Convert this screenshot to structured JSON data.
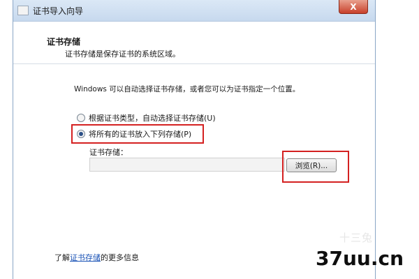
{
  "window": {
    "title": "证书导入向导",
    "close_label": "X"
  },
  "header": {
    "title": "证书存储",
    "description": "证书存储是保存证书的系统区域。"
  },
  "content": {
    "intro": "Windows 可以自动选择证书存储，或者您可以为证书指定一个位置。",
    "options": [
      {
        "label": "根据证书类型，自动选择证书存储(U)",
        "selected": false
      },
      {
        "label": "将所有的证书放入下列存储(P)",
        "selected": true
      }
    ],
    "store_label": "证书存储：",
    "store_value": "",
    "browse_label": "浏览(R)..."
  },
  "footer": {
    "prefix": "了解",
    "link": "证书存储",
    "suffix": "的更多信息"
  },
  "watermark": {
    "faint": "十三兔",
    "text": "37uu.cn"
  },
  "colors": {
    "highlight_box": "#d42121",
    "link": "#1a53b6",
    "titlebar": "#c7d9ee"
  }
}
